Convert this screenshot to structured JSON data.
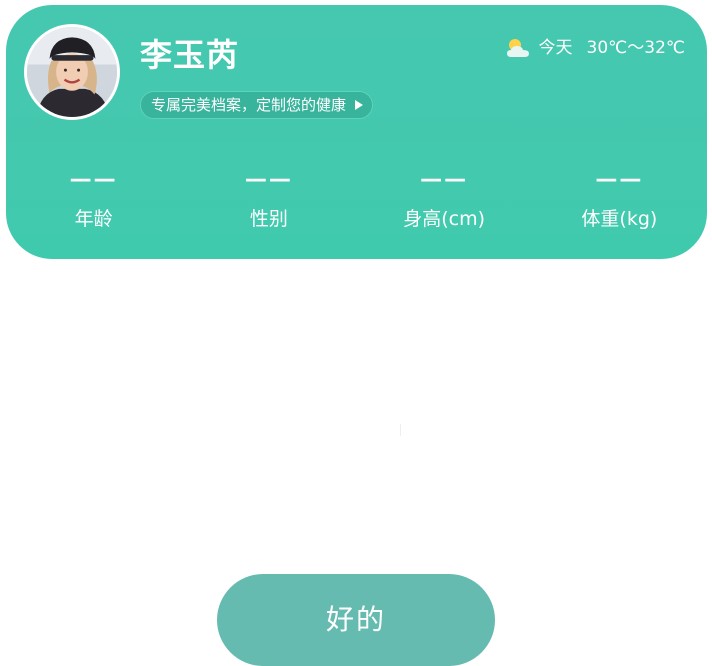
{
  "profile": {
    "name": "李玉芮",
    "pill_text": "专属完美档案，定制您的健康"
  },
  "weather": {
    "icon": "partly-cloudy-icon",
    "day": "今天",
    "temp_range": "30℃～32℃"
  },
  "stats": [
    {
      "value": "——",
      "label": "年龄"
    },
    {
      "value": "——",
      "label": "性别"
    },
    {
      "value": "——",
      "label": "身高(cm)"
    },
    {
      "value": "——",
      "label": "体重(kg)"
    }
  ],
  "actions": {
    "ok_label": "好的"
  },
  "colors": {
    "card": "#40caad",
    "pill": "#38b39c",
    "button": "#66bbb0"
  }
}
